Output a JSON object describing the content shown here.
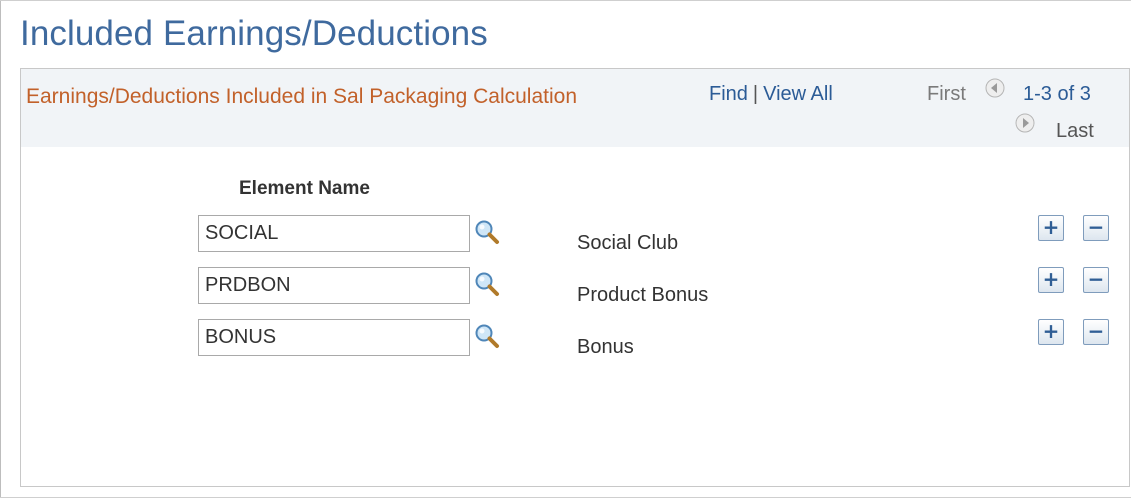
{
  "page": {
    "title": "Included Earnings/Deductions"
  },
  "grid": {
    "title": "Earnings/Deductions Included in Sal Packaging Calculation",
    "nav": {
      "find": "Find",
      "separator": "|",
      "view_all": "View All",
      "first": "First",
      "range": "1-3 of 3",
      "last": "Last",
      "prev_icon": "left-arrow-circle-icon",
      "next_icon": "right-arrow-circle-icon"
    },
    "column_header": "Element Name",
    "rows": [
      {
        "code": "SOCIAL",
        "description": "Social Club"
      },
      {
        "code": "PRDBON",
        "description": "Product Bonus"
      },
      {
        "code": "BONUS",
        "description": "Bonus"
      }
    ],
    "add_label": "+",
    "delete_label": "−"
  },
  "colors": {
    "page_title": "#3f6a9e",
    "grid_title": "#c2612a",
    "link": "#2b5b96",
    "header_bg": "#f1f4f7"
  }
}
